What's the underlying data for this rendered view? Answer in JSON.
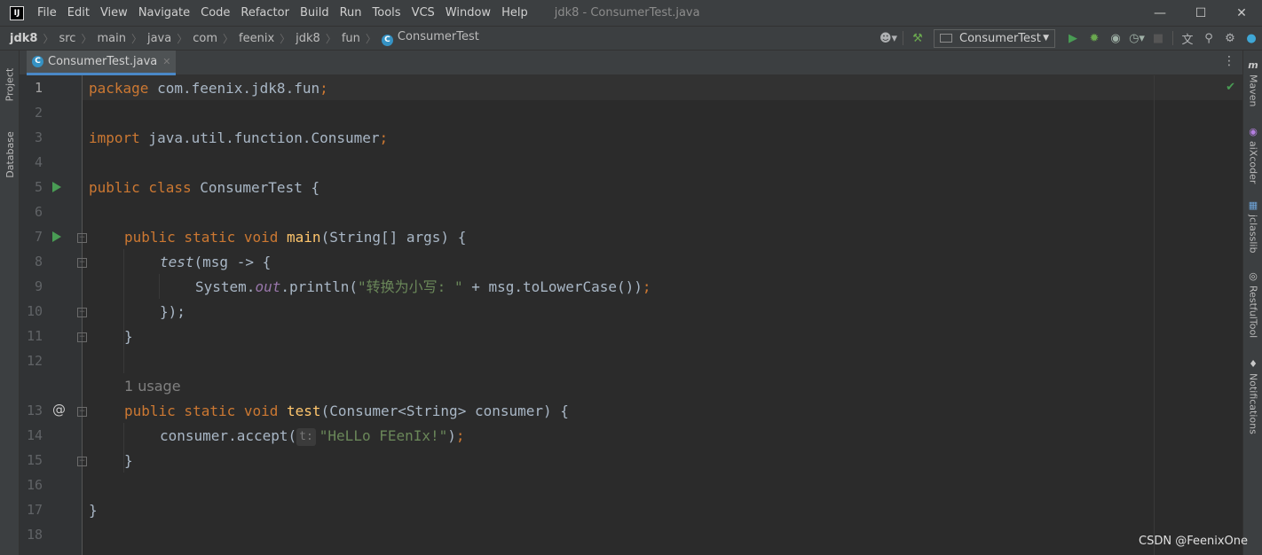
{
  "menu": {
    "items": [
      "File",
      "Edit",
      "View",
      "Navigate",
      "Code",
      "Refactor",
      "Build",
      "Run",
      "Tools",
      "VCS",
      "Window",
      "Help"
    ],
    "window_title": "jdk8 - ConsumerTest.java",
    "logo": "IJ"
  },
  "breadcrumb": {
    "items": [
      "jdk8",
      "src",
      "main",
      "java",
      "com",
      "feenix",
      "jdk8",
      "fun"
    ],
    "current": "ConsumerTest"
  },
  "toolbar": {
    "run_config": "ConsumerTest",
    "icons": [
      "user-icon",
      "build-hammer-icon",
      "run-icon",
      "debug-icon",
      "coverage-icon",
      "profile-icon",
      "stop-icon",
      "translate-icon",
      "search-icon",
      "settings-gear-icon",
      "update-icon"
    ]
  },
  "tabs": [
    {
      "label": "ConsumerTest.java",
      "active": true
    }
  ],
  "left_tools": [
    "Project",
    "Database"
  ],
  "right_tools": [
    "Maven",
    "aiXcoder",
    "jclasslib",
    "RestfulTool",
    "Notifications"
  ],
  "editor": {
    "current_line": 1,
    "usage_hint": "1 usage",
    "param_hint": "t:",
    "line_numbers": [
      "1",
      "2",
      "3",
      "4",
      "5",
      "6",
      "7",
      "8",
      "9",
      "10",
      "11",
      "12",
      "13",
      "14",
      "15",
      "16",
      "17",
      "18"
    ],
    "code": {
      "l1_kw": "package",
      "l1_rest": " com.feenix.jdk8.fun",
      "semi": ";",
      "l3_kw": "import",
      "l3_rest": " java.util.function.Consumer",
      "l5_kw": "public class",
      "l5_rest": " ConsumerTest {",
      "l7_kw": "public static void",
      "l7_fn": "main",
      "l7_rest": "(String[] args) {",
      "l8_fn": "test",
      "l8_rest": "(msg -> {",
      "l9_a": "System.",
      "l9_field": "out",
      "l9_b": ".println(",
      "l9_str": "\"转换为小写: \"",
      "l9_c": " + msg.toLowerCase())",
      "l10": "});",
      "l11": "}",
      "l13_kw": "public static void",
      "l13_fn": "test",
      "l13_rest": "(Consumer<String> consumer) {",
      "l14_a": "consumer.accept(",
      "l14_str": "\"HeLLo FEenIx!\"",
      "l14_b": ")",
      "l15": "}",
      "l17": "}"
    }
  },
  "watermark": "CSDN @FeenixOne"
}
